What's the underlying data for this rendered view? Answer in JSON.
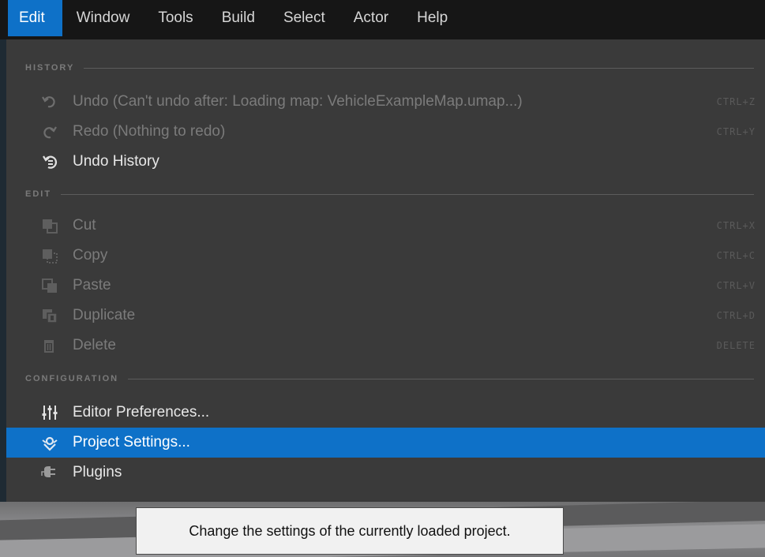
{
  "menubar": {
    "items": [
      {
        "label": "Edit",
        "active": true
      },
      {
        "label": "Window"
      },
      {
        "label": "Tools"
      },
      {
        "label": "Build"
      },
      {
        "label": "Select"
      },
      {
        "label": "Actor"
      },
      {
        "label": "Help"
      }
    ]
  },
  "sections": {
    "history": "HISTORY",
    "edit": "EDIT",
    "configuration": "CONFIGURATION"
  },
  "items": {
    "undo": {
      "label": "Undo (Can't undo after: Loading map: VehicleExampleMap.umap...)",
      "shortcut": "CTRL+Z",
      "icon": "undo-icon"
    },
    "redo": {
      "label": "Redo (Nothing to redo)",
      "shortcut": "CTRL+Y",
      "icon": "redo-icon"
    },
    "undo_history": {
      "label": "Undo History",
      "icon": "undo-history-icon"
    },
    "cut": {
      "label": "Cut",
      "shortcut": "CTRL+X",
      "icon": "cut-icon"
    },
    "copy": {
      "label": "Copy",
      "shortcut": "CTRL+C",
      "icon": "copy-icon"
    },
    "paste": {
      "label": "Paste",
      "shortcut": "CTRL+V",
      "icon": "paste-icon"
    },
    "duplicate": {
      "label": "Duplicate",
      "shortcut": "CTRL+D",
      "icon": "duplicate-icon"
    },
    "delete": {
      "label": "Delete",
      "shortcut": "DELETE",
      "icon": "trash-icon"
    },
    "editor_preferences": {
      "label": "Editor Preferences...",
      "icon": "sliders-icon"
    },
    "project_settings": {
      "label": "Project Settings...",
      "icon": "project-settings-icon"
    },
    "plugins": {
      "label": "Plugins",
      "icon": "plug-icon"
    }
  },
  "tooltip": {
    "text": "Change the settings of the currently loaded project."
  },
  "colors": {
    "accent": "#0e71c8",
    "panel": "#3a3a3a",
    "menubar": "#161616"
  }
}
